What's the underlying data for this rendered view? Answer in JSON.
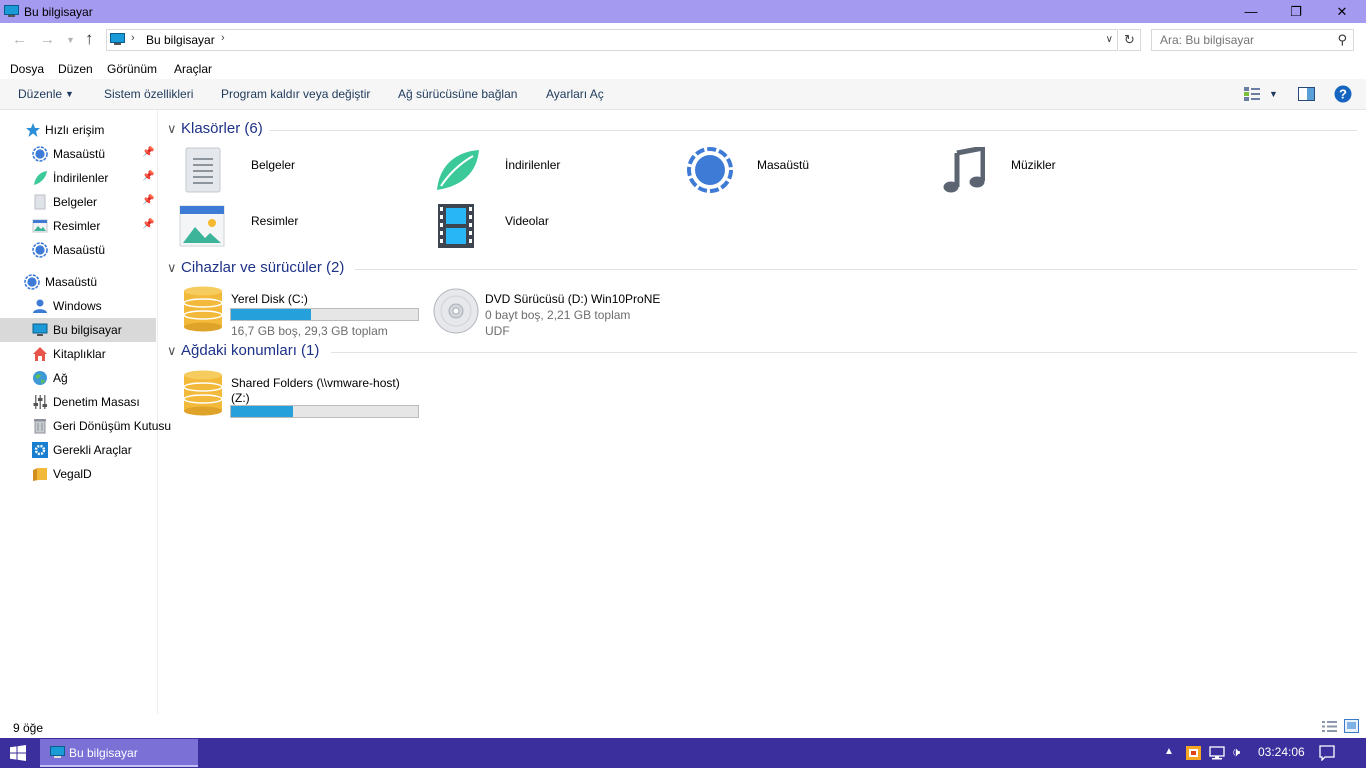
{
  "window": {
    "title": "Bu bilgisayar"
  },
  "address": {
    "crumb": "Bu bilgisayar",
    "search_placeholder": "Ara: Bu bilgisayar"
  },
  "menu": [
    "Dosya",
    "Düzen",
    "Görünüm",
    "Araçlar"
  ],
  "toolbar": {
    "organize": "Düzenle",
    "system_properties": "Sistem özellikleri",
    "uninstall": "Program kaldır veya değiştir",
    "map_drive": "Ağ sürücüsüne bağlan",
    "open_settings": "Ayarları Aç"
  },
  "sidebar": {
    "quick_access": "Hızlı erişim",
    "quick_items": [
      {
        "label": "Masaüstü",
        "icon": "desktop-icon",
        "pinned": true
      },
      {
        "label": "İndirilenler",
        "icon": "downloads-icon",
        "pinned": true
      },
      {
        "label": "Belgeler",
        "icon": "documents-icon",
        "pinned": true
      },
      {
        "label": "Resimler",
        "icon": "pictures-icon",
        "pinned": true
      },
      {
        "label": "Masaüstü",
        "icon": "desktop-icon",
        "pinned": false
      }
    ],
    "desktop_root": "Masaüstü",
    "tree_items": [
      {
        "label": "Windows",
        "icon": "user-icon"
      },
      {
        "label": "Bu bilgisayar",
        "icon": "computer-icon",
        "selected": true
      },
      {
        "label": "Kitaplıklar",
        "icon": "libraries-icon"
      },
      {
        "label": "Ağ",
        "icon": "network-icon"
      },
      {
        "label": "Denetim Masası",
        "icon": "control-panel-icon"
      },
      {
        "label": "Geri Dönüşüm Kutusu",
        "icon": "recycle-bin-icon"
      },
      {
        "label": "Gerekli Araçlar",
        "icon": "tools-icon"
      },
      {
        "label": "VegalD",
        "icon": "folder-icon"
      }
    ]
  },
  "groups": {
    "folders": {
      "title": "Klasörler (6)",
      "items": [
        {
          "label": "Belgeler",
          "icon": "documents-icon"
        },
        {
          "label": "İndirilenler",
          "icon": "downloads-icon"
        },
        {
          "label": "Masaüstü",
          "icon": "desktop-icon"
        },
        {
          "label": "Müzikler",
          "icon": "music-icon"
        },
        {
          "label": "Resimler",
          "icon": "pictures-icon"
        },
        {
          "label": "Videolar",
          "icon": "videos-icon"
        }
      ]
    },
    "devices": {
      "title": "Cihazlar ve sürücüler (2)",
      "items": [
        {
          "label": "Yerel Disk (C:)",
          "free_text": "16,7 GB boş, 29,3 GB toplam",
          "used_fraction": 0.43,
          "icon": "hard-drive-icon"
        },
        {
          "label": "DVD Sürücüsü (D:) Win10ProNE",
          "free_text": "0 bayt boş, 2,21 GB toplam",
          "fs_text": "UDF",
          "icon": "dvd-icon"
        }
      ]
    },
    "network": {
      "title": "Ağdaki konumları (1)",
      "items": [
        {
          "label_line1": "Shared Folders (\\\\vmware-host)",
          "label_line2": "(Z:)",
          "used_fraction": 0.33,
          "icon": "network-drive-icon"
        }
      ]
    }
  },
  "status": {
    "count": "9 öğe"
  },
  "taskbar": {
    "window_label": "Bu bilgisayar",
    "clock": "03:24:06"
  },
  "colors": {
    "accent": "#a49af0",
    "taskbar": "#3b2f9e",
    "bar_fill": "#26a0da",
    "group_title": "#1e3287"
  }
}
